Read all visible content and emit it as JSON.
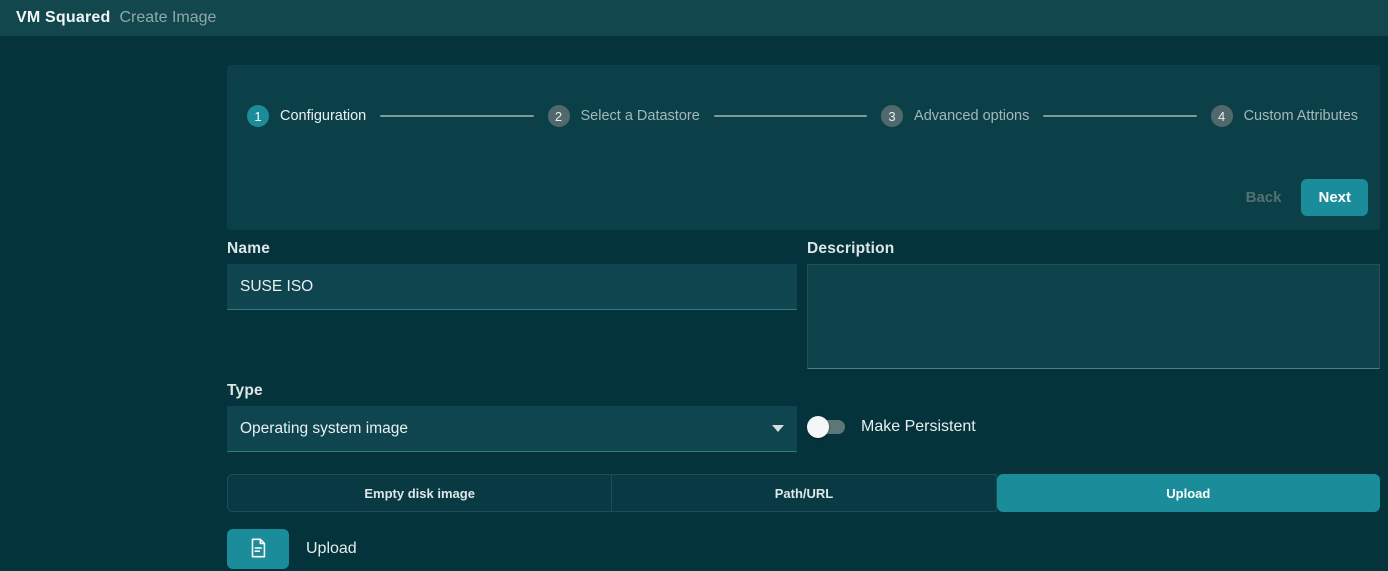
{
  "header": {
    "brand": "VM Squared",
    "page_title": "Create Image"
  },
  "wizard": {
    "steps": [
      {
        "number": "1",
        "label": "Configuration",
        "active": true
      },
      {
        "number": "2",
        "label": "Select a Datastore",
        "active": false
      },
      {
        "number": "3",
        "label": "Advanced options",
        "active": false
      },
      {
        "number": "4",
        "label": "Custom Attributes",
        "active": false
      }
    ],
    "back_label": "Back",
    "next_label": "Next"
  },
  "form": {
    "name": {
      "label": "Name",
      "value": "SUSE ISO"
    },
    "description": {
      "label": "Description",
      "value": ""
    },
    "type": {
      "label": "Type",
      "value": "Operating system image"
    },
    "make_persistent": {
      "label": "Make Persistent",
      "enabled": false
    },
    "source_tabs": [
      {
        "label": "Empty disk image",
        "selected": false
      },
      {
        "label": "Path/URL",
        "selected": false
      },
      {
        "label": "Upload",
        "selected": true
      }
    ],
    "upload": {
      "icon": "document-icon",
      "label": "Upload"
    }
  },
  "colors": {
    "accent": "#1b8c99",
    "header_bg": "#13474e",
    "page_bg": "#04333c",
    "card_bg": "#0c4049",
    "input_bg": "#0f454e"
  }
}
